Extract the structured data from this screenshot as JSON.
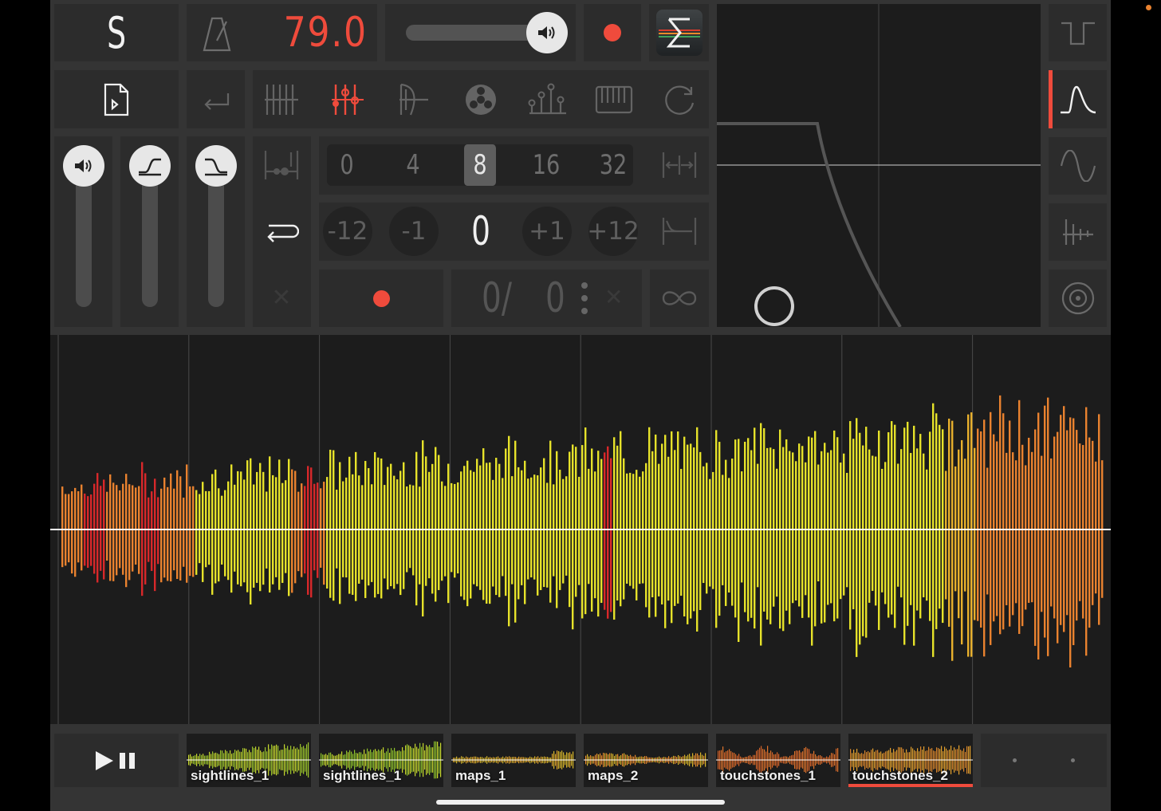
{
  "app": {
    "logo_letter": "S"
  },
  "transport": {
    "tempo": "79.0"
  },
  "quantize": {
    "options": [
      "0",
      "4",
      "8",
      "16",
      "32"
    ],
    "selected": "8"
  },
  "transpose": {
    "options": [
      "-12",
      "-1",
      "0",
      "+1",
      "+12"
    ],
    "selected": "0"
  },
  "counter": {
    "left": "0/",
    "right": "0"
  },
  "clips": [
    {
      "label": "sightlines_1"
    },
    {
      "label": "sightlines_1"
    },
    {
      "label": "maps_1"
    },
    {
      "label": "maps_2"
    },
    {
      "label": "touchstones_1"
    },
    {
      "label": "touchstones_2",
      "selected": true
    }
  ],
  "colors": {
    "accent": "#ef4b3c",
    "wave_red": "#d8282a",
    "wave_orange": "#e9822f",
    "wave_yellow": "#e6e22a"
  },
  "icons": {
    "top_row": [
      "logo-icon",
      "metronome-icon",
      "volume-icon",
      "record-icon",
      "sigma-icon"
    ],
    "mode_row": [
      "file-icon",
      "arrow-left-icon",
      "track-grid-icon",
      "mixer-icon",
      "harp-icon",
      "reel-icon",
      "nodes-icon",
      "keyboard-icon",
      "loop-icon"
    ],
    "waveform_shapes": [
      "square-wave-icon",
      "exp-decay-icon",
      "sine-wave-icon",
      "comb-icon",
      "target-icon"
    ]
  }
}
